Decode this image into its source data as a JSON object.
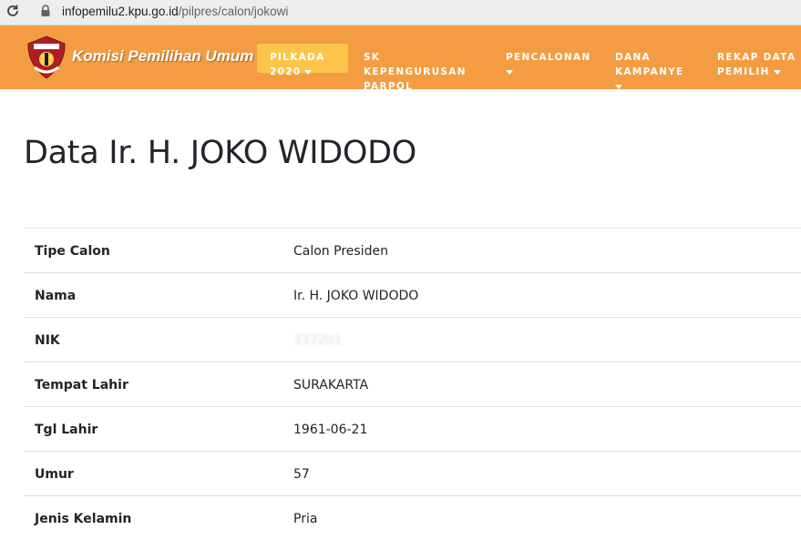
{
  "browser": {
    "url_host": "infopemilu2.kpu.go.id",
    "url_path": "/pilpres/calon/jokowi"
  },
  "nav": {
    "brand": "Komisi Pemilihan Umum",
    "logo_text": "KOMISI PEMILIHAN UMUM",
    "menu": [
      {
        "line1": "PILKADA",
        "line2": "2020"
      },
      {
        "line1": "SK",
        "line2": "KEPENGURUSAN",
        "line3": "PARPOL"
      },
      {
        "line1": "PENCALONAN"
      },
      {
        "line1": "DANA",
        "line2": "KAMPANYE"
      },
      {
        "line1": "REKAP DATA",
        "line2": "PEMILIH"
      }
    ],
    "colors": {
      "bar": "#f39c42",
      "active": "#fbc549"
    }
  },
  "page": {
    "title": "Data Ir. H. JOKO WIDODO"
  },
  "table": {
    "rows": [
      {
        "label": "Tipe Calon",
        "value": "Calon Presiden"
      },
      {
        "label": "Nama",
        "value": "Ir. H. JOKO WIDODO"
      },
      {
        "label": "NIK",
        "value": "337201"
      },
      {
        "label": "Tempat Lahir",
        "value": "SURAKARTA"
      },
      {
        "label": "Tgl Lahir",
        "value": "1961-06-21"
      },
      {
        "label": "Umur",
        "value": "57"
      },
      {
        "label": "Jenis Kelamin",
        "value": "Pria"
      }
    ]
  }
}
